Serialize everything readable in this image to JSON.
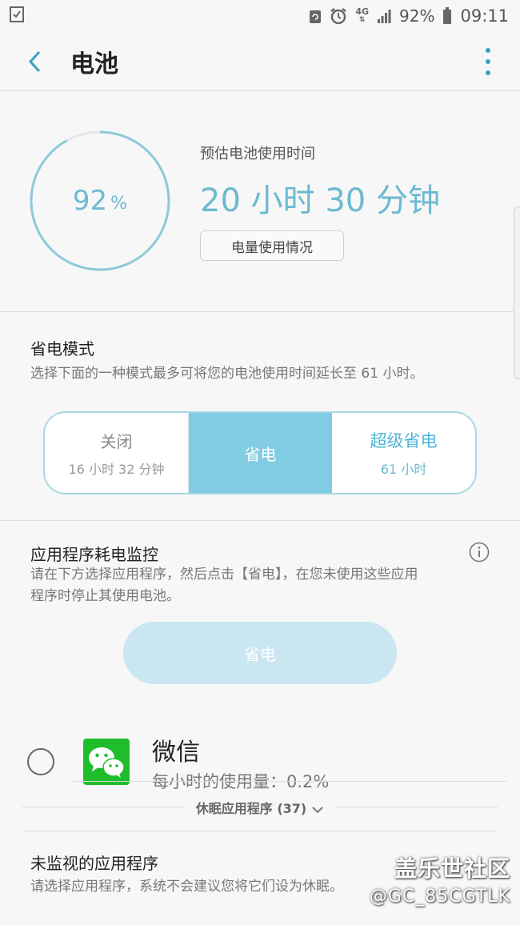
{
  "status_bar": {
    "network": "4G",
    "battery_percent": "92%",
    "time": "09:11"
  },
  "app_bar": {
    "title": "电池"
  },
  "battery": {
    "level": 92,
    "level_number": "92",
    "level_unit": "%",
    "estimate_label": "预估电池使用时间",
    "estimate_value": "20 小时 30 分钟",
    "usage_button": "电量使用情况"
  },
  "power_saving": {
    "title": "省电模式",
    "description": "选择下面的一种模式最多可将您的电池使用时间延长至 61 小时。",
    "modes": [
      {
        "name": "关闭",
        "sub": "16 小时 32 分钟"
      },
      {
        "name": "省电",
        "sub": ""
      },
      {
        "name": "超级省电",
        "sub": "61 小时"
      }
    ],
    "selected_mode": "省电"
  },
  "app_monitor": {
    "title": "应用程序耗电监控",
    "description_line1": "请在下方选择应用程序，然后点击【省电】，在您未使用这些应用",
    "description_line2": "程序时停止其使用电池。",
    "save_button": "省电",
    "apps": [
      {
        "name": "微信",
        "usage": "每小时的使用量：0.2%"
      }
    ],
    "sleeping_apps_label": "休眠应用程序 (37)",
    "unmonitored_title": "未监视的应用程序",
    "unmonitored_desc": "请选择应用程序，系统不会建议您将它们设为休眠。"
  },
  "watermark": {
    "title": "盖乐世社区",
    "user": "@GC_85CGTLK"
  },
  "colors": {
    "accent": "#6bbad0",
    "selected_mode_bg": "#81cbe3",
    "wechat_green": "#1fbd2c"
  }
}
